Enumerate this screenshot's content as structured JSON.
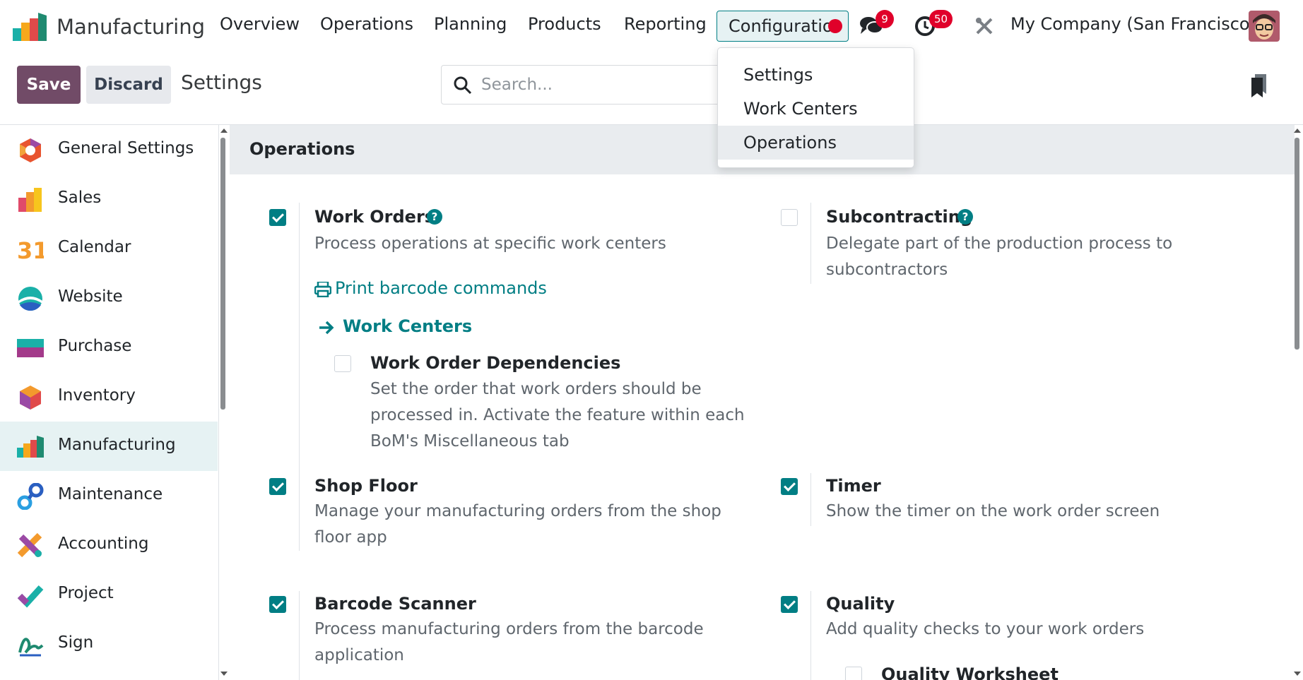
{
  "app": {
    "name": "Manufacturing",
    "menu": [
      "Overview",
      "Operations",
      "Planning",
      "Products",
      "Reporting",
      "Configuration"
    ],
    "active_menu_display": "Configuratio",
    "messages_count": "9",
    "activities_count": "50",
    "company": "My Company (San Francisco)"
  },
  "control_panel": {
    "save_label": "Save",
    "discard_label": "Discard",
    "title": "Settings",
    "search_placeholder": "Search..."
  },
  "sidebar": {
    "items": [
      {
        "label": "General Settings",
        "icon": "general-settings-icon"
      },
      {
        "label": "Sales",
        "icon": "sales-icon"
      },
      {
        "label": "Calendar",
        "icon": "calendar-icon",
        "icon_text": "31"
      },
      {
        "label": "Website",
        "icon": "website-icon"
      },
      {
        "label": "Purchase",
        "icon": "purchase-icon"
      },
      {
        "label": "Inventory",
        "icon": "inventory-icon"
      },
      {
        "label": "Manufacturing",
        "icon": "manufacturing-icon",
        "active": true
      },
      {
        "label": "Maintenance",
        "icon": "maintenance-icon"
      },
      {
        "label": "Accounting",
        "icon": "accounting-icon"
      },
      {
        "label": "Project",
        "icon": "project-icon"
      },
      {
        "label": "Sign",
        "icon": "sign-icon"
      }
    ]
  },
  "section": {
    "title": "Operations",
    "settings": {
      "work_orders": {
        "title": "Work Orders",
        "desc": "Process operations at specific work centers",
        "checked": true
      },
      "print_barcode": "Print barcode commands",
      "work_centers_link": "Work Centers",
      "work_order_dependencies": {
        "title": "Work Order Dependencies",
        "desc": "Set the order that work orders should be processed in. Activate the feature within each BoM's Miscellaneous tab",
        "checked": false
      },
      "subcontracting": {
        "title": "Subcontracting",
        "desc": "Delegate part of the production process to subcontractors",
        "checked": false
      },
      "shop_floor": {
        "title": "Shop Floor",
        "desc": "Manage your manufacturing orders from the shop floor app",
        "checked": true
      },
      "timer": {
        "title": "Timer",
        "desc": "Show the timer on the work order screen",
        "checked": true
      },
      "barcode_scanner": {
        "title": "Barcode Scanner",
        "desc": "Process manufacturing orders from the barcode application",
        "checked": true
      },
      "quality": {
        "title": "Quality",
        "desc": "Add quality checks to your work orders",
        "checked": true
      },
      "quality_worksheet": {
        "title": "Quality Worksheet",
        "checked": false
      }
    }
  },
  "dropdown": {
    "items": [
      "Settings",
      "Work Centers",
      "Operations"
    ],
    "hovered": "Operations"
  },
  "colors": {
    "primary": "#714b67",
    "accent": "#017e84",
    "badge": "#e0002a"
  }
}
